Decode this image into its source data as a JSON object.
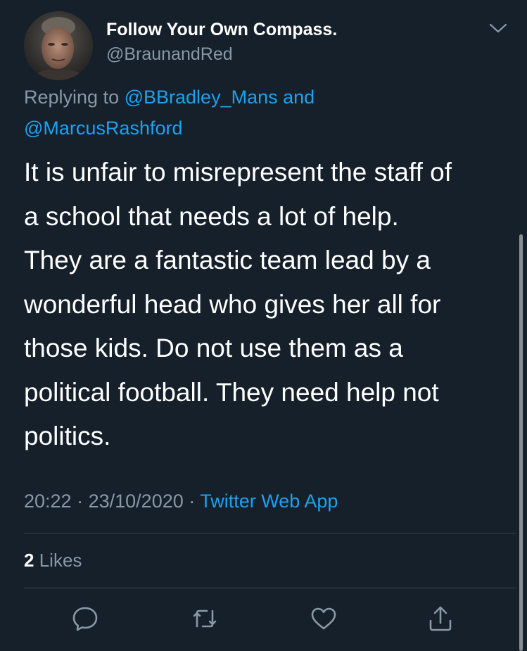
{
  "author": {
    "display_name": "Follow Your Own Compass.",
    "handle": "@BraunandRed"
  },
  "reply": {
    "prefix": "Replying to",
    "mention_1": "@BBradley_Mans",
    "conjunction": "and",
    "mention_2": "@MarcusRashford"
  },
  "tweet": {
    "lines": [
      "It is unfair to misrepresent the staff of",
      "a school that needs a lot of help.",
      "They are a fantastic team lead by a",
      "wonderful head who gives her all for",
      "those kids. Do not use them as a",
      "political football. They need help not",
      "politics."
    ],
    "time": "20:22",
    "separator": "·",
    "date": "23/10/2020",
    "source": "Twitter Web App"
  },
  "stats": {
    "likes_count": "2",
    "likes_label": "Likes"
  },
  "icons": {
    "caret": "chevron-down-icon",
    "reply": "reply-icon",
    "retweet": "retweet-icon",
    "like": "heart-icon",
    "share": "share-icon"
  },
  "colors": {
    "background": "#15202b",
    "text": "#ffffff",
    "secondary": "#8899a6",
    "accent": "#1da1f2",
    "divider": "#38444d"
  }
}
